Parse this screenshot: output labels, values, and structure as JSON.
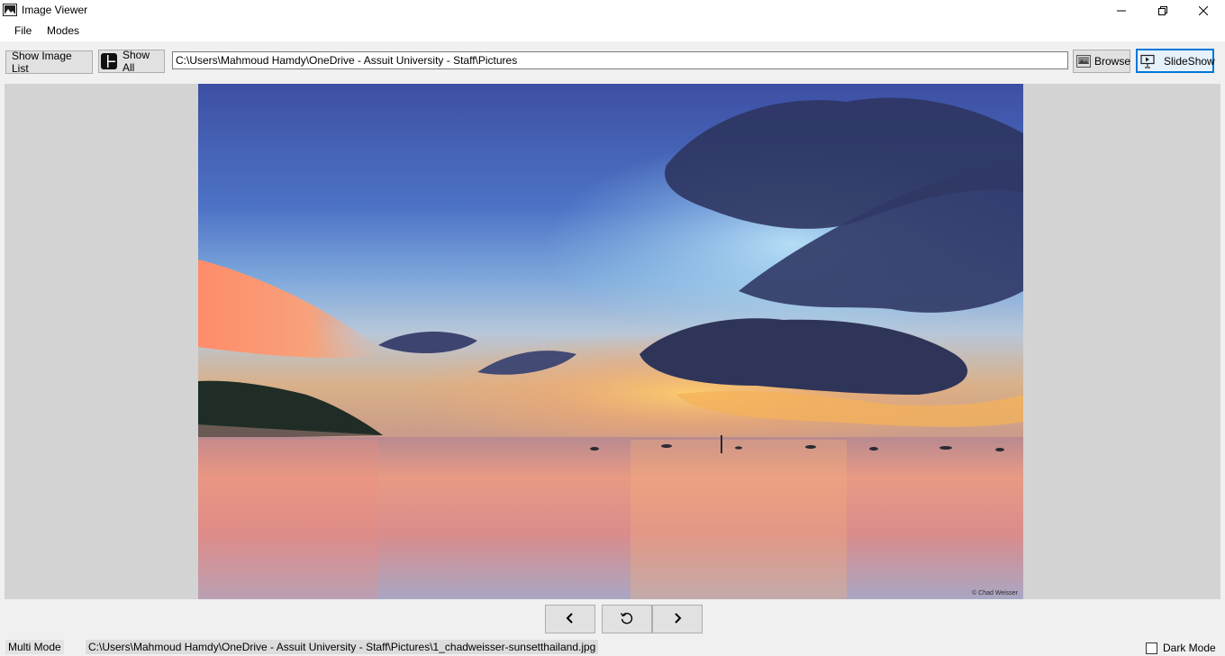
{
  "window": {
    "title": "Image Viewer",
    "icon": "image-app-icon",
    "controls": [
      "minimize-icon",
      "restore-icon",
      "close-icon"
    ]
  },
  "menu": {
    "items": [
      {
        "label": "File"
      },
      {
        "label": "Modes"
      }
    ]
  },
  "toolbar": {
    "show_list_label": "Show Image List",
    "show_all_label": "Show All",
    "path_value": "C:\\Users\\Mahmoud Hamdy\\OneDrive - Assuit University - Staff\\Pictures",
    "browse_label": "Browse",
    "slideshow_label": "SlideShow"
  },
  "viewer": {
    "image_credit": "© Chad Weisser"
  },
  "navigation": {
    "icons": [
      "chevron-left-icon",
      "rotate-reset-icon",
      "chevron-right-icon"
    ]
  },
  "status": {
    "mode": "Multi Mode",
    "file_path": "C:\\Users\\Mahmoud Hamdy\\OneDrive - Assuit University - Staff\\Pictures\\1_chadweisser-sunsetthailand.jpg",
    "dark_mode_label": "Dark Mode",
    "dark_mode_checked": false
  },
  "colors": {
    "accent": "#0078d7",
    "viewer_bg": "#d3d3d3",
    "window_bg": "#f0f0f0"
  }
}
